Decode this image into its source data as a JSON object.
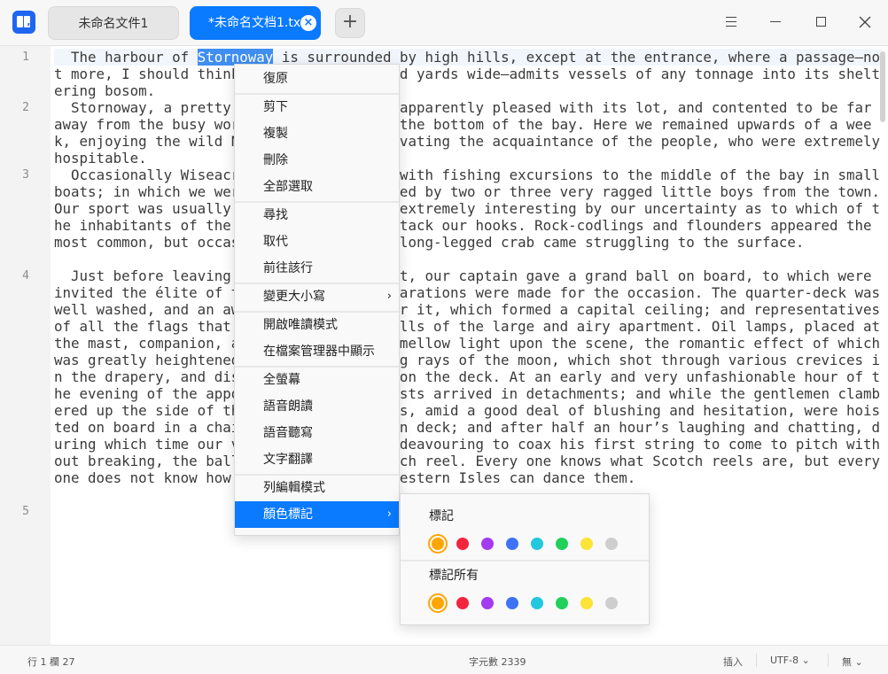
{
  "titlebar": {
    "tabs": [
      {
        "label": "未命名文件1"
      },
      {
        "label": "*未命名文档1.txt"
      }
    ],
    "add_tab": "+",
    "close_tab": "×"
  },
  "editor": {
    "line_numbers": [
      "1",
      "2",
      "3",
      "4",
      "5"
    ],
    "paragraphs": [
      {
        "before": "  The harbour of ",
        "selected": "Stornoway",
        "after": " is surrounded by high hills, except at the entrance, where a passage—not more, I should think, than a few hundred yards wide—admits vessels of any tonnage into its sheltering bosom."
      },
      {
        "text": "  Stornoway, a pretty considerable town, apparently pleased with its lot, and contented to be far away from the busy world, lies snugly at the bottom of the bay. Here we remained upwards of a week, enjoying the wild Nor’-West, and cultivating the acquaintance of the people, who were extremely hospitable."
      },
      {
        "text": "  Occasionally Wiseacre amused ourselves with fishing excursions to the middle of the bay in small boats; in which we were usually accompanied by two or three very ragged little boys from the town. Our sport was usually good, and rendered extremely interesting by our uncertainty as to which of the inhabitants of the deep would first attack our hooks. Rock-codlings and flounders appeared the most common, but occasionally a skate or long-legged crab came struggling to the surface."
      },
      {
        "text": "  Just before leaving this hospitable spot, our captain gave a grand ball on board, to which were invited the élite of the town. Great preparations were made for the occasion. The quarter-deck was well washed, and an awning was spread over it, which formed a capital ceiling; and representatives of all the flags that waves formed the walls of the large and airy apartment. Oil lamps, placed at the mast, companion, and capstan, shed a mellow light upon the scene, the romantic effect of which was greatly heightened by a few flickering rays of the moon, which shot through various crevices in the drapery, and disported playfully upon the deck. At an early and very unfashionable hour of the evening of the appointed night the guests arrived in detachments; and while the gentlemen clambered up the side of the vessel, the ladies, amid a good deal of blushing and hesitation, were hoisted on board in a chair. Tea was served on deck; and after half an hour’s laughing and chatting, during which time our violin-player was endeavouring to coax his first string to come to pitch without breaking, the ball opened with a Scotch reel. Every one knows what Scotch reels are, but every one does not know how the belles of the Western Isles can dance them."
      }
    ]
  },
  "context_menu": {
    "items": [
      {
        "label": "復原"
      },
      {
        "label": "剪下"
      },
      {
        "label": "複製"
      },
      {
        "label": "刪除"
      },
      {
        "label": "全部選取"
      },
      {
        "label": "尋找"
      },
      {
        "label": "取代"
      },
      {
        "label": "前往該行"
      },
      {
        "label": "變更大小寫",
        "submenu": true
      },
      {
        "label": "開啟唯讀模式"
      },
      {
        "label": "在檔案管理器中顯示"
      },
      {
        "label": "全螢幕"
      },
      {
        "label": "語音朗讀"
      },
      {
        "label": "語音聽寫"
      },
      {
        "label": "文字翻譯"
      },
      {
        "label": "列編輯模式"
      },
      {
        "label": "顏色標記",
        "submenu": true,
        "active": true
      }
    ],
    "chevron": "›"
  },
  "color_submenu": {
    "mark_label": "標記",
    "mark_all_label": "標記所有",
    "colors": [
      "#ffa500",
      "#f2253f",
      "#a53bf0",
      "#3f73f5",
      "#22c7e0",
      "#21d05a",
      "#fbe337",
      "#cecece"
    ]
  },
  "statusbar": {
    "position": "行 1  欄 27",
    "char_count": "字元數 2339",
    "mode": "插入",
    "encoding": "UTF-8",
    "highlight": "無",
    "chevron": "⌄"
  }
}
